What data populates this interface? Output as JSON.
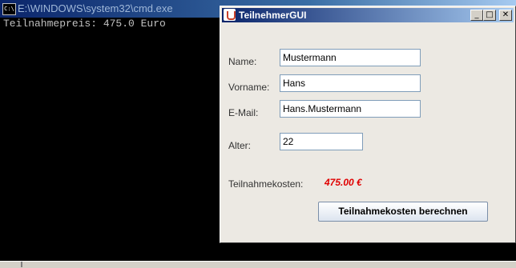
{
  "cmd": {
    "title": "E:\\WINDOWS\\system32\\cmd.exe",
    "icon": "cmd-icon",
    "icon_text": "C:\\",
    "output": "Teilnahmepreis: 475.0 Euro"
  },
  "gui": {
    "title": "TeilnehmerGUI",
    "window_buttons": {
      "minimize": "_",
      "maximize": "□",
      "close": "✕"
    },
    "fields": {
      "name": {
        "label": "Name:",
        "value": "Mustermann"
      },
      "vorname": {
        "label": "Vorname:",
        "value": "Hans"
      },
      "email": {
        "label": "E-Mail:",
        "value": "Hans.Mustermann"
      },
      "alter": {
        "label": "Alter:",
        "value": "22"
      }
    },
    "cost_label": "Teilnahmekosten:",
    "cost_value": "475.00 €",
    "calculate_button": "Teilnahmekosten berechnen",
    "colors": {
      "cost": "#e00000",
      "titlebar": "#0a246a"
    }
  }
}
